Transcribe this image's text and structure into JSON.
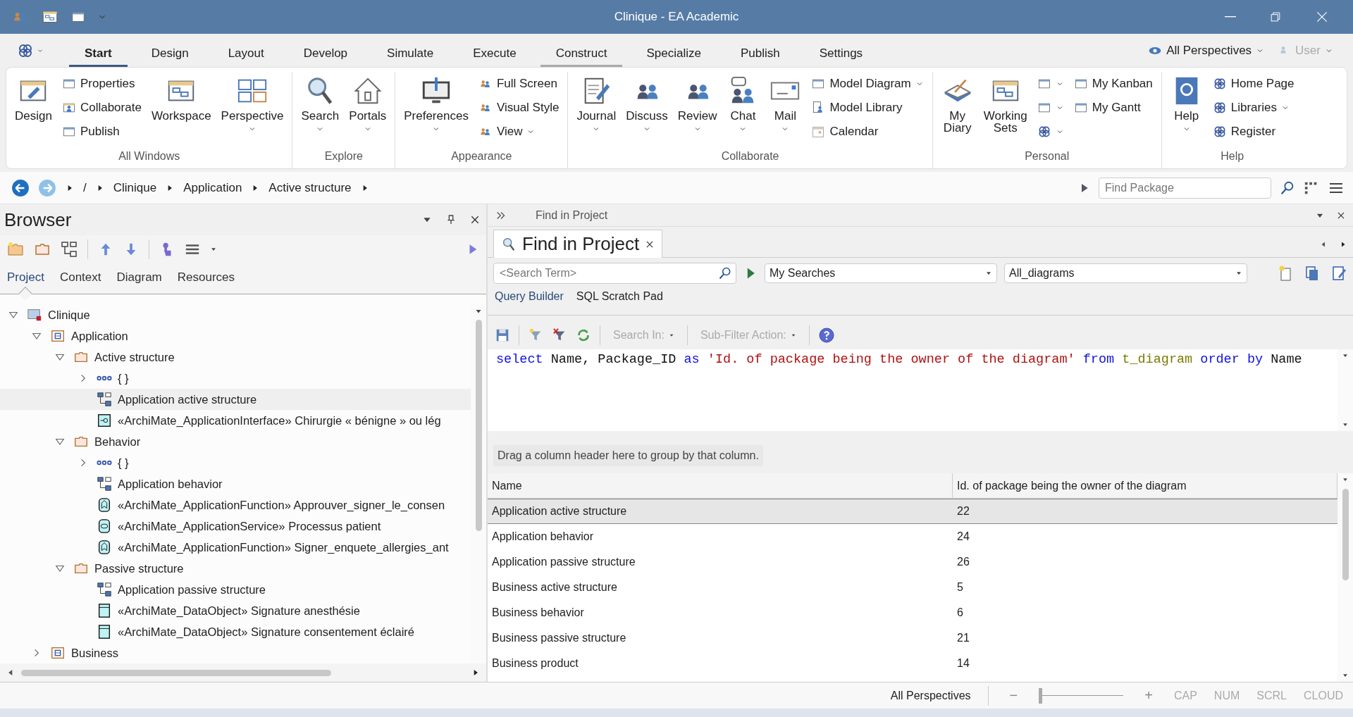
{
  "window": {
    "title": "Clinique - EA Academic"
  },
  "menu": {
    "tabs": [
      {
        "label": "Start",
        "selected": true,
        "hovered": false
      },
      {
        "label": "Design",
        "selected": false,
        "hovered": false
      },
      {
        "label": "Layout",
        "selected": false,
        "hovered": false
      },
      {
        "label": "Develop",
        "selected": false,
        "hovered": false
      },
      {
        "label": "Simulate",
        "selected": false,
        "hovered": false
      },
      {
        "label": "Execute",
        "selected": false,
        "hovered": false
      },
      {
        "label": "Construct",
        "selected": false,
        "hovered": true
      },
      {
        "label": "Specialize",
        "selected": false,
        "hovered": false
      },
      {
        "label": "Publish",
        "selected": false,
        "hovered": false
      },
      {
        "label": "Settings",
        "selected": false,
        "hovered": false
      }
    ],
    "perspective": "All Perspectives",
    "user": {
      "label": "User",
      "disabled": true
    }
  },
  "ribbon": {
    "groups": [
      {
        "label": "All Windows",
        "items": [
          {
            "kind": "large",
            "label": "Design",
            "dropdown": false
          },
          {
            "kind": "stack",
            "entries": [
              {
                "label": "Properties",
                "dropdown": false
              },
              {
                "label": "Collaborate",
                "dropdown": false
              },
              {
                "label": "Publish",
                "dropdown": false
              }
            ]
          },
          {
            "kind": "large",
            "label": "Workspace",
            "dropdown": false
          },
          {
            "kind": "large",
            "label": "Perspective",
            "dropdown": true
          }
        ]
      },
      {
        "label": "Explore",
        "items": [
          {
            "kind": "large",
            "label": "Search",
            "dropdown": true
          },
          {
            "kind": "large",
            "label": "Portals",
            "dropdown": true
          }
        ]
      },
      {
        "label": "Appearance",
        "items": [
          {
            "kind": "large",
            "label": "Preferences",
            "dropdown": true
          },
          {
            "kind": "stack",
            "entries": [
              {
                "label": "Full Screen",
                "dropdown": false
              },
              {
                "label": "Visual Style",
                "dropdown": false
              },
              {
                "label": "View",
                "dropdown": true
              }
            ]
          }
        ]
      },
      {
        "label": "Collaborate",
        "items": [
          {
            "kind": "large",
            "label": "Journal",
            "dropdown": true
          },
          {
            "kind": "large",
            "label": "Discuss",
            "dropdown": true
          },
          {
            "kind": "large",
            "label": "Review",
            "dropdown": true
          },
          {
            "kind": "large",
            "label": "Chat",
            "dropdown": true
          },
          {
            "kind": "large",
            "label": "Mail",
            "dropdown": true
          },
          {
            "kind": "stack",
            "entries": [
              {
                "label": "Model Diagram",
                "dropdown": true
              },
              {
                "label": "Model Library",
                "dropdown": false
              },
              {
                "label": "Calendar",
                "dropdown": false
              }
            ]
          }
        ]
      },
      {
        "label": "Personal",
        "items": [
          {
            "kind": "large",
            "label": "My\nDiary",
            "dropdown": false
          },
          {
            "kind": "large",
            "label": "Working\nSets",
            "dropdown": false
          },
          {
            "kind": "stack",
            "entries": [
              {
                "dropdown": true
              },
              {
                "dropdown": true
              },
              {
                "dropdown": true
              }
            ]
          },
          {
            "kind": "stack",
            "entries": [
              {
                "label": "My Kanban",
                "dropdown": false
              },
              {
                "label": "My Gantt",
                "dropdown": false
              }
            ]
          }
        ]
      },
      {
        "label": "Help",
        "items": [
          {
            "kind": "large",
            "label": "Help",
            "dropdown": true
          },
          {
            "kind": "stack",
            "entries": [
              {
                "label": "Home Page",
                "dropdown": false
              },
              {
                "label": "Libraries",
                "dropdown": true
              },
              {
                "label": "Register",
                "dropdown": false
              }
            ]
          }
        ]
      }
    ]
  },
  "breadcrumb": {
    "root": "/",
    "items": [
      "Clinique",
      "Application",
      "Active structure"
    ],
    "search_placeholder": "Find Package"
  },
  "browser": {
    "title": "Browser",
    "tabs": [
      {
        "label": "Project",
        "selected": true
      },
      {
        "label": "Context",
        "selected": false
      },
      {
        "label": "Diagram",
        "selected": false
      },
      {
        "label": "Resources",
        "selected": false
      }
    ],
    "tree": [
      {
        "label": "Clinique",
        "kind": "model",
        "expanded": true,
        "selected": false,
        "children": [
          {
            "label": "Application",
            "kind": "package",
            "expanded": true,
            "selected": false,
            "children": [
              {
                "label": "Active structure",
                "kind": "folder",
                "expanded": true,
                "selected": false,
                "children": [
                  {
                    "label": "{ }",
                    "kind": "ellipsis",
                    "expanded": false,
                    "selected": false
                  },
                  {
                    "label": "Application active structure",
                    "kind": "diagram",
                    "selected": true
                  },
                  {
                    "label": "«ArchiMate_ApplicationInterface» Chirurgie « bénigne » ou lég",
                    "kind": "interface",
                    "selected": false
                  }
                ]
              },
              {
                "label": "Behavior",
                "kind": "folder",
                "expanded": true,
                "selected": false,
                "children": [
                  {
                    "label": "{ }",
                    "kind": "ellipsis",
                    "expanded": false,
                    "selected": false
                  },
                  {
                    "label": "Application behavior",
                    "kind": "diagram",
                    "selected": false
                  },
                  {
                    "label": "«ArchiMate_ApplicationFunction» Approuver_signer_le_consen",
                    "kind": "function",
                    "selected": false
                  },
                  {
                    "label": "«ArchiMate_ApplicationService» Processus patient",
                    "kind": "service",
                    "selected": false
                  },
                  {
                    "label": "«ArchiMate_ApplicationFunction» Signer_enquete_allergies_ant",
                    "kind": "function",
                    "selected": false
                  }
                ]
              },
              {
                "label": "Passive structure",
                "kind": "folder",
                "expanded": true,
                "selected": false,
                "children": [
                  {
                    "label": "Application passive structure",
                    "kind": "diagram",
                    "selected": false
                  },
                  {
                    "label": "«ArchiMate_DataObject» Signature anesthésie",
                    "kind": "dataobject",
                    "selected": false
                  },
                  {
                    "label": "«ArchiMate_DataObject» Signature consentement éclairé",
                    "kind": "dataobject",
                    "selected": false
                  }
                ]
              }
            ]
          },
          {
            "label": "Business",
            "kind": "package",
            "expanded": false,
            "selected": false
          }
        ]
      }
    ]
  },
  "find_panel": {
    "header": "Find in Project",
    "tab": "Find in Project",
    "search_placeholder": "<Search Term>",
    "searches": "My Searches",
    "query": "All_diagrams",
    "subtabs": [
      {
        "label": "Query Builder",
        "selected": true
      },
      {
        "label": "SQL Scratch Pad",
        "selected": false
      }
    ],
    "toolbar": {
      "search_in": "Search In:",
      "sub_filter": "Sub-Filter Action:"
    },
    "sql": [
      {
        "text": "select",
        "kind": "keyword"
      },
      {
        "text": "Name,",
        "kind": "ident"
      },
      {
        "text": "Package_ID",
        "kind": "ident"
      },
      {
        "text": "as",
        "kind": "keyword"
      },
      {
        "text": "'Id. of package being the owner of the diagram'",
        "kind": "string"
      },
      {
        "text": "from",
        "kind": "keyword"
      },
      {
        "text": "t_diagram",
        "kind": "table"
      },
      {
        "text": "order",
        "kind": "keyword"
      },
      {
        "text": "by",
        "kind": "keyword"
      },
      {
        "text": "Name",
        "kind": "ident"
      }
    ],
    "group_hint": "Drag a column header here to group by that column.",
    "table": {
      "columns": [
        "Name",
        "Id. of package being the owner of the diagram"
      ],
      "rows": [
        {
          "cells": [
            "Application active structure",
            "22"
          ],
          "selected": true
        },
        {
          "cells": [
            "Application behavior",
            "24"
          ],
          "selected": false
        },
        {
          "cells": [
            "Application passive structure",
            "26"
          ],
          "selected": false
        },
        {
          "cells": [
            "Business active structure",
            "5"
          ],
          "selected": false
        },
        {
          "cells": [
            "Business behavior",
            "6"
          ],
          "selected": false
        },
        {
          "cells": [
            "Business passive structure",
            "21"
          ],
          "selected": false
        },
        {
          "cells": [
            "Business product",
            "14"
          ],
          "selected": false
        }
      ]
    }
  },
  "status_bar": {
    "perspective": "All Perspectives",
    "zoom": {
      "minus": "−",
      "plus": "+",
      "level": 0
    },
    "indicators": [
      {
        "label": "CAP",
        "on": false
      },
      {
        "label": "NUM",
        "on": false
      },
      {
        "label": "SCRL",
        "on": false
      },
      {
        "label": "CLOUD",
        "on": false
      }
    ]
  }
}
